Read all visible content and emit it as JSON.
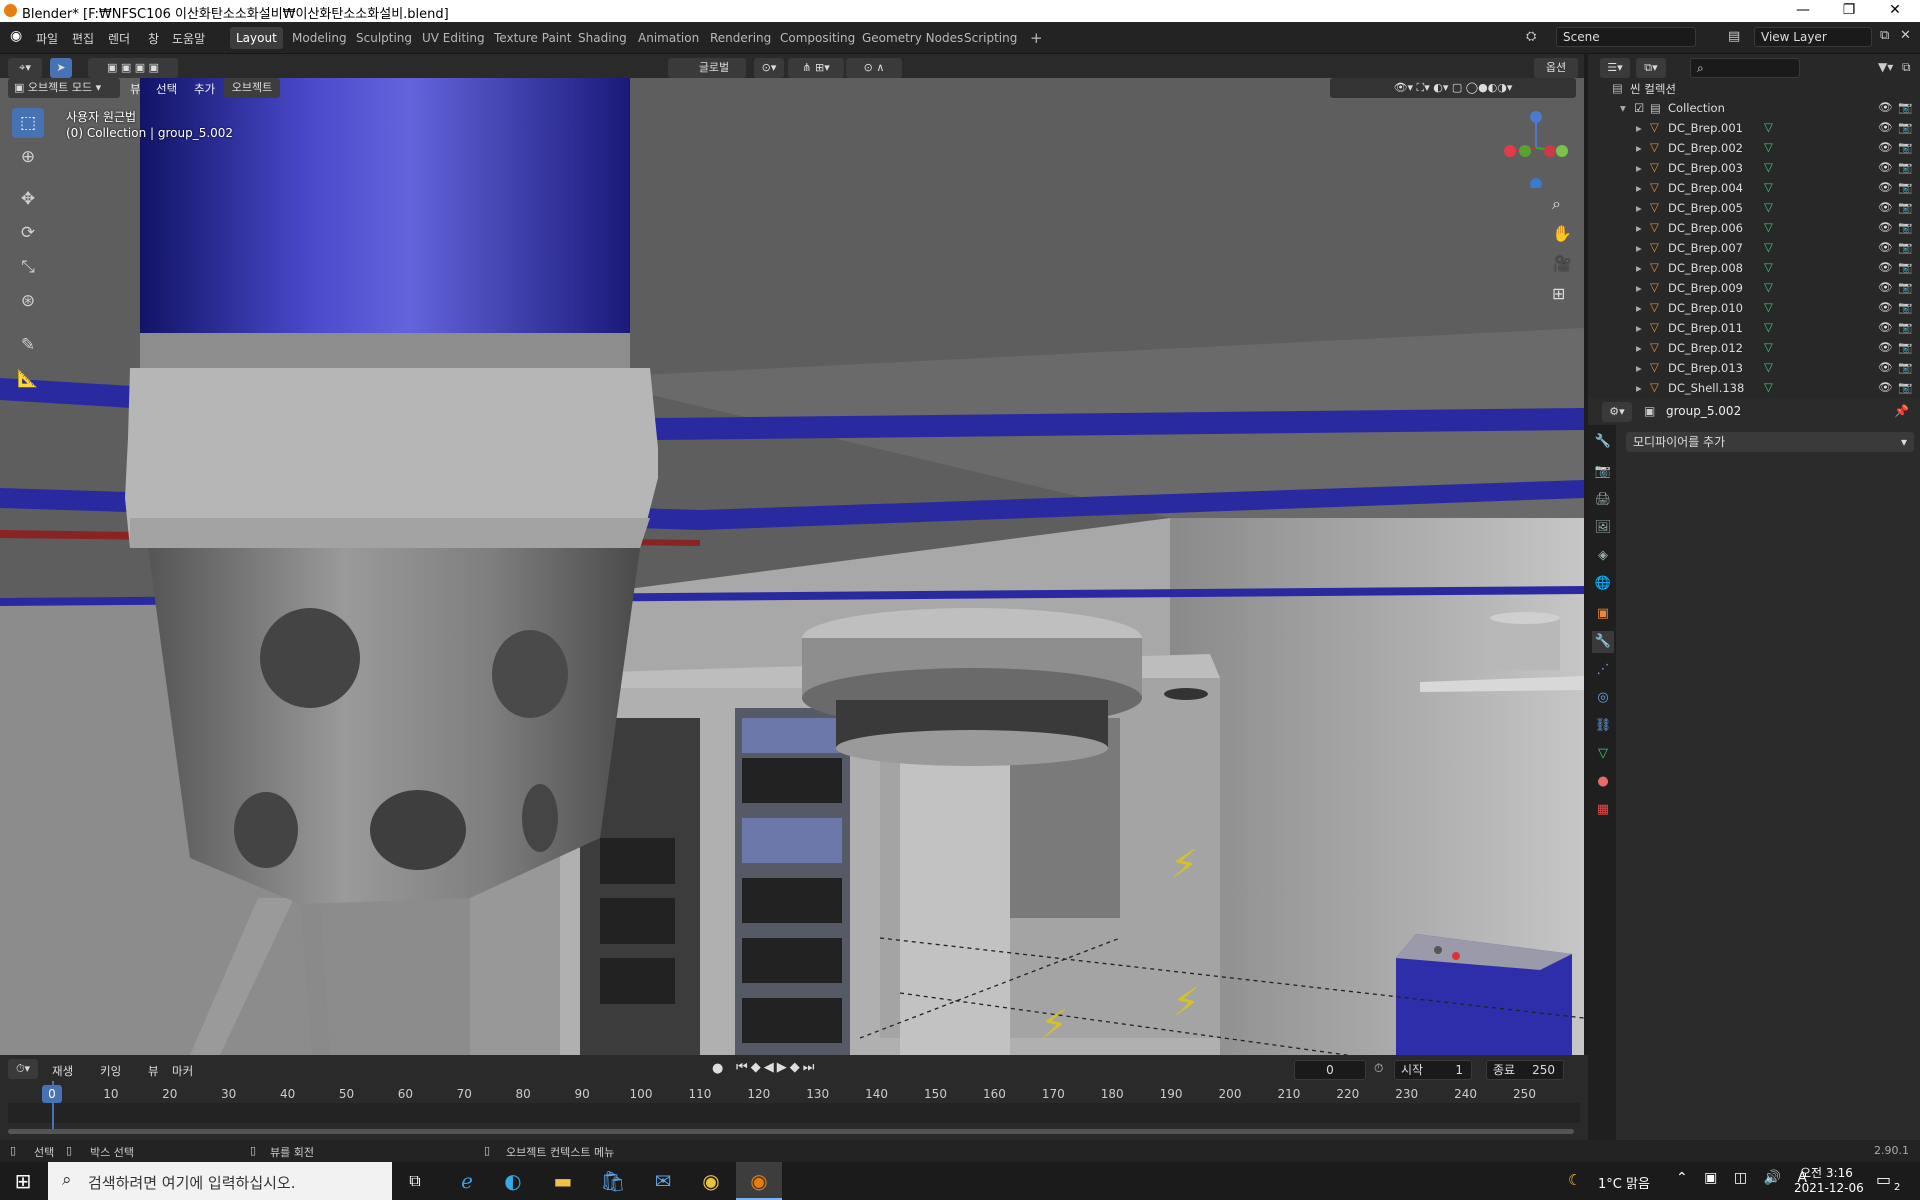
{
  "window": {
    "title": "Blender* [F:₩NFSC106 이산화탄소소화설비₩이산화탄소소화설비.blend]",
    "min": "—",
    "max": "❐",
    "close": "✕"
  },
  "menu": {
    "file": "파일",
    "edit": "편집",
    "render": "렌더",
    "window": "창",
    "help": "도움말"
  },
  "workspaces": [
    "Layout",
    "Modeling",
    "Sculpting",
    "UV Editing",
    "Texture Paint",
    "Shading",
    "Animation",
    "Rendering",
    "Compositing",
    "Geometry Nodes",
    "Scripting"
  ],
  "scene": {
    "name": "Scene",
    "view_layer": "View Layer"
  },
  "viewport": {
    "orientation": "글로벌",
    "options": "옵션",
    "mode": "오브젝트 모드",
    "menus": {
      "view": "뷰",
      "select": "선택",
      "add": "추가",
      "object": "오브젝트"
    },
    "info_line1": "사용자 원근법",
    "info_line2": "(0) Collection | group_5.002"
  },
  "outliner": {
    "root": "씬 컬렉션",
    "collection": "Collection",
    "items": [
      "DC_Brep.001",
      "DC_Brep.002",
      "DC_Brep.003",
      "DC_Brep.004",
      "DC_Brep.005",
      "DC_Brep.006",
      "DC_Brep.007",
      "DC_Brep.008",
      "DC_Brep.009",
      "DC_Brep.010",
      "DC_Brep.011",
      "DC_Brep.012",
      "DC_Brep.013",
      "DC_Shell.138"
    ]
  },
  "properties": {
    "object": "group_5.002",
    "add_modifier": "모디파이어를 추가"
  },
  "timeline": {
    "menus": {
      "playback": "재생",
      "keying": "키잉",
      "view": "뷰",
      "marker": "마커"
    },
    "current": "0",
    "start_label": "시작",
    "start": "1",
    "end_label": "종료",
    "end": "250",
    "ticks": [
      "0",
      "10",
      "20",
      "30",
      "40",
      "50",
      "60",
      "70",
      "80",
      "90",
      "100",
      "110",
      "120",
      "130",
      "140",
      "150",
      "160",
      "170",
      "180",
      "190",
      "200",
      "210",
      "220",
      "230",
      "240",
      "250"
    ]
  },
  "status": {
    "select": "선택",
    "box_select": "박스 선택",
    "rotate": "뷰를 회전",
    "context": "오브젝트 컨텍스트 메뉴",
    "version": "2.90.1"
  },
  "taskbar": {
    "search": "검색하려면 여기에 입력하십시오.",
    "weather": "1°C 맑음",
    "time": "오전 3:16",
    "date": "2021-12-06",
    "notif": "2"
  },
  "colors": {
    "accent": "#4772b3",
    "pipe": "#2a2aa0",
    "mesh_icon": "#e8893a",
    "data_icon": "#3ec77a"
  }
}
